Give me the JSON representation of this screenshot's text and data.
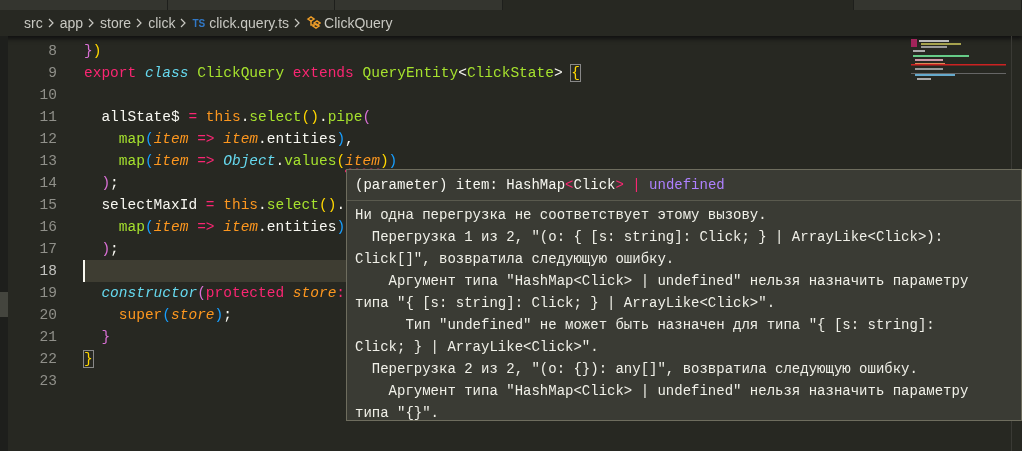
{
  "tabs": [
    {
      "selected": false
    },
    {
      "selected": false
    },
    {
      "selected": false
    },
    {
      "selected": true
    },
    {
      "selected": false
    }
  ],
  "breadcrumb": [
    {
      "kind": "folder",
      "label": "src"
    },
    {
      "kind": "folder",
      "label": "app"
    },
    {
      "kind": "folder",
      "label": "store"
    },
    {
      "kind": "folder",
      "label": "click"
    },
    {
      "kind": "file",
      "badge": "TS",
      "label": "click.query.ts"
    },
    {
      "kind": "symbol",
      "label": "ClickQuery"
    }
  ],
  "code": {
    "lines": [
      {
        "number": "8",
        "current": false,
        "tokens": [
          {
            "kind": "b2",
            "text": "}"
          },
          {
            "kind": "b1",
            "text": ")"
          }
        ]
      },
      {
        "number": "9",
        "current": false,
        "tokens": [
          {
            "kind": "kw",
            "text": "export "
          },
          {
            "kind": "st",
            "text": "class "
          },
          {
            "kind": "cls",
            "text": "ClickQuery "
          },
          {
            "kind": "kw",
            "text": "extends "
          },
          {
            "kind": "cls",
            "text": "QueryEntity"
          },
          {
            "kind": "p",
            "text": "<"
          },
          {
            "kind": "cls",
            "text": "ClickState"
          },
          {
            "kind": "p",
            "text": "> "
          },
          {
            "kind": "bx",
            "text": "{"
          }
        ]
      },
      {
        "number": "10",
        "current": false
      },
      {
        "number": "11",
        "current": false,
        "tokens": [
          {
            "kind": "p",
            "text": "  allState$ "
          },
          {
            "kind": "kw",
            "text": "= "
          },
          {
            "kind": "th",
            "text": "this"
          },
          {
            "kind": "p",
            "text": "."
          },
          {
            "kind": "fn",
            "text": "select"
          },
          {
            "kind": "b1",
            "text": "()"
          },
          {
            "kind": "p",
            "text": "."
          },
          {
            "kind": "fn",
            "text": "pipe"
          },
          {
            "kind": "b2",
            "text": "("
          }
        ]
      },
      {
        "number": "12",
        "current": false,
        "tokens": [
          {
            "kind": "fn",
            "text": "    map"
          },
          {
            "kind": "b3",
            "text": "("
          },
          {
            "kind": "pa",
            "text": "item "
          },
          {
            "kind": "kw",
            "text": "=> "
          },
          {
            "kind": "pa",
            "text": "item"
          },
          {
            "kind": "p",
            "text": ".entities"
          },
          {
            "kind": "b3",
            "text": ")"
          },
          {
            "kind": "p",
            "text": ","
          }
        ]
      },
      {
        "number": "13",
        "current": false,
        "tokens": [
          {
            "kind": "fn",
            "text": "    map"
          },
          {
            "kind": "b3",
            "text": "("
          },
          {
            "kind": "pa",
            "text": "item "
          },
          {
            "kind": "kw",
            "text": "=> "
          },
          {
            "kind": "st",
            "text": "Object"
          },
          {
            "kind": "p",
            "text": "."
          },
          {
            "kind": "fn",
            "text": "values"
          },
          {
            "kind": "b1",
            "text": "("
          },
          {
            "kind": "pa",
            "text": "item",
            "error": true
          },
          {
            "kind": "b1",
            "text": ")"
          },
          {
            "kind": "b3",
            "text": ")"
          }
        ]
      },
      {
        "number": "14",
        "current": false,
        "tokens": [
          {
            "kind": "b2",
            "text": "  )"
          },
          {
            "kind": "p",
            "text": ";"
          }
        ]
      },
      {
        "number": "15",
        "current": false,
        "tokens": [
          {
            "kind": "p",
            "text": "  selectMaxId "
          },
          {
            "kind": "kw",
            "text": "= "
          },
          {
            "kind": "th",
            "text": "this"
          },
          {
            "kind": "p",
            "text": "."
          },
          {
            "kind": "fn",
            "text": "select"
          },
          {
            "kind": "b1",
            "text": "()"
          },
          {
            "kind": "p",
            "text": "."
          }
        ]
      },
      {
        "number": "16",
        "current": false,
        "tokens": [
          {
            "kind": "fn",
            "text": "    map"
          },
          {
            "kind": "b3",
            "text": "("
          },
          {
            "kind": "pa",
            "text": "item "
          },
          {
            "kind": "kw",
            "text": "=> "
          },
          {
            "kind": "pa",
            "text": "item"
          },
          {
            "kind": "p",
            "text": ".entities"
          },
          {
            "kind": "b3",
            "text": ")"
          }
        ]
      },
      {
        "number": "17",
        "current": false,
        "tokens": [
          {
            "kind": "b2",
            "text": "  )"
          },
          {
            "kind": "p",
            "text": ";"
          }
        ]
      },
      {
        "number": "18",
        "current": true
      },
      {
        "number": "19",
        "current": false,
        "tokens": [
          {
            "kind": "st",
            "text": "  constructor"
          },
          {
            "kind": "b2",
            "text": "("
          },
          {
            "kind": "kw",
            "text": "protected "
          },
          {
            "kind": "pa",
            "text": "store"
          },
          {
            "kind": "kw",
            "text": ":"
          }
        ]
      },
      {
        "number": "20",
        "current": false,
        "tokens": [
          {
            "kind": "th",
            "text": "    super"
          },
          {
            "kind": "b3",
            "text": "("
          },
          {
            "kind": "pa",
            "text": "store"
          },
          {
            "kind": "b3",
            "text": ")"
          },
          {
            "kind": "p",
            "text": ";"
          }
        ]
      },
      {
        "number": "21",
        "current": false,
        "tokens": [
          {
            "kind": "b2",
            "text": "  }"
          }
        ]
      },
      {
        "number": "22",
        "current": false,
        "tokens": [
          {
            "kind": "bx",
            "text": "}"
          }
        ]
      },
      {
        "number": "23",
        "current": false
      }
    ]
  },
  "hover": {
    "signature": [
      {
        "kind": "p",
        "text": "(parameter) item: HashMap"
      },
      {
        "kind": "op",
        "text": "<"
      },
      {
        "kind": "p",
        "text": "Click"
      },
      {
        "kind": "op",
        "text": "> |"
      },
      {
        "kind": "num",
        "text": " undefined"
      }
    ],
    "message_lines": [
      "Ни одна перегрузка не соответствует этому вызову.",
      "  Перегрузка 1 из 2, \"(o: { [s: string]: Click; } | ArrayLike<Click>):",
      "Click[]\", возвратила следующую ошибку.",
      "    Аргумент типа \"HashMap<Click> | undefined\" нельзя назначить параметру",
      "типа \"{ [s: string]: Click; } | ArrayLike<Click>\".",
      "      Тип \"undefined\" не может быть назначен для типа \"{ [s: string]:",
      "Click; } | ArrayLike<Click>\".",
      "  Перегрузка 2 из 2, \"(o: {}): any[]\", возвратила следующую ошибку.",
      "    Аргумент типа \"HashMap<Click> | undefined\" нельзя назначить параметру",
      "типа \"{}\"."
    ]
  }
}
